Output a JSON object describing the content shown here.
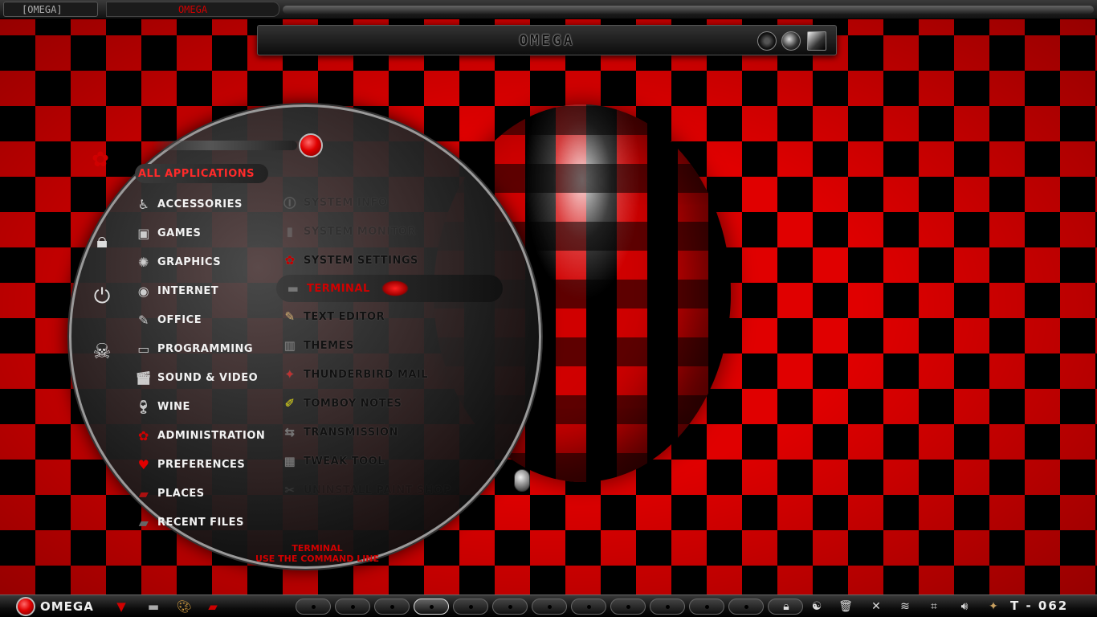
{
  "top_panel": {
    "tab1_label": "[OMEGA]",
    "tab2_label": "OMEGA"
  },
  "window": {
    "title": "OMEGA"
  },
  "sidebar_icons": [
    "settings-icon",
    "lock-icon",
    "logout-icon",
    "skull-crossbones-icon"
  ],
  "menu": {
    "categories": [
      {
        "label": "ALL APPLICATIONS",
        "icon": "all-apps-icon",
        "selected": true
      },
      {
        "label": "ACCESSORIES",
        "icon": "accessories-icon"
      },
      {
        "label": "GAMES",
        "icon": "games-icon"
      },
      {
        "label": "GRAPHICS",
        "icon": "graphics-icon"
      },
      {
        "label": "INTERNET",
        "icon": "internet-icon"
      },
      {
        "label": "OFFICE",
        "icon": "office-icon"
      },
      {
        "label": "PROGRAMMING",
        "icon": "programming-icon"
      },
      {
        "label": "SOUND & VIDEO",
        "icon": "sound-video-icon"
      },
      {
        "label": "WINE",
        "icon": "wine-icon"
      },
      {
        "label": "ADMINISTRATION",
        "icon": "administration-icon"
      },
      {
        "label": "PREFERENCES",
        "icon": "heart-icon"
      },
      {
        "label": "PLACES",
        "icon": "folder-icon"
      },
      {
        "label": "RECENT FILES",
        "icon": "recent-files-icon"
      }
    ],
    "apps": [
      {
        "label": "SYSTEM INFO",
        "icon": "info-icon"
      },
      {
        "label": "SYSTEM MONITOR",
        "icon": "monitor-icon"
      },
      {
        "label": "SYSTEM SETTINGS",
        "icon": "settings-icon"
      },
      {
        "label": "TERMINAL",
        "icon": "terminal-icon",
        "selected": true
      },
      {
        "label": "TEXT EDITOR",
        "icon": "text-editor-icon"
      },
      {
        "label": "THEMES",
        "icon": "themes-icon"
      },
      {
        "label": "THUNDERBIRD MAIL",
        "icon": "thunderbird-icon"
      },
      {
        "label": "TOMBOY NOTES",
        "icon": "tomboy-icon"
      },
      {
        "label": "TRANSMISSION",
        "icon": "transmission-icon"
      },
      {
        "label": "TWEAK TOOL",
        "icon": "tweak-tool-icon"
      },
      {
        "label": "UNINSTALL PAINT SHOP",
        "icon": "uninstall-icon"
      }
    ],
    "description_title": "TERMINAL",
    "description_text": "USE THE COMMAND LINE"
  },
  "bottom_panel": {
    "menu_label": "OMEGA",
    "clock": "T - 062",
    "launchers": [
      "chevron-down-icon",
      "terminal-icon",
      "palette-icon",
      "folder-icon"
    ],
    "tray_icons": [
      "lock-icon",
      "yin-yang-icon",
      "trash-icon",
      "close-icon",
      "wifi-icon",
      "network-icon",
      "volume-icon",
      "eagle-icon"
    ],
    "workspace_count": 13,
    "active_workspace": 4
  },
  "colors": {
    "accent": "#e00000",
    "panel": "#1b1b1b",
    "checker_dark": "#000000"
  }
}
